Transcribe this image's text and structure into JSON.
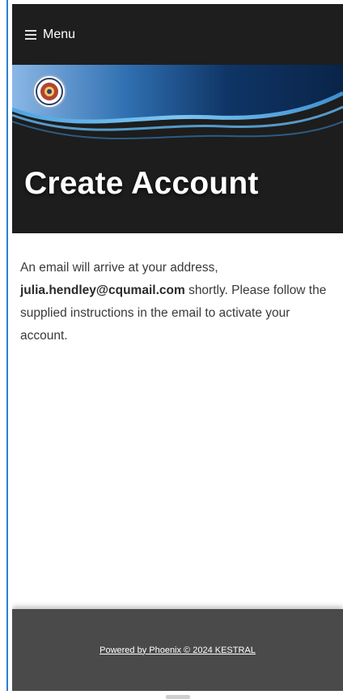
{
  "menubar": {
    "menu_label": "Menu"
  },
  "hero": {
    "title": "Create Account"
  },
  "content": {
    "message_prefix": "An email will arrive at your address,",
    "email": "julia.hendley@cqumail.com",
    "message_suffix": "shortly. Please follow the supplied instructions in the email to activate your account."
  },
  "footer": {
    "link_text": "Powered by Phoenix © 2024 KESTRAL"
  },
  "colors": {
    "menubar_bg": "#1e1e1e",
    "hero_bg": "#1d1d1d",
    "footer_bg": "#4a4a4a",
    "accent_blue": "#2c7fd4"
  }
}
